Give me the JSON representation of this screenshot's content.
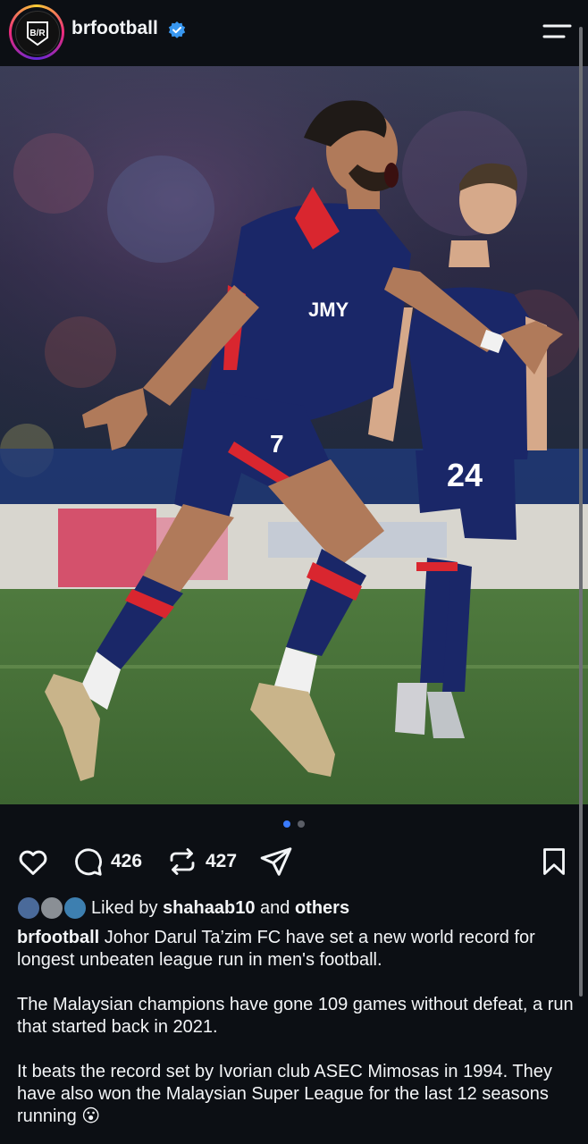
{
  "header": {
    "username": "brfootball",
    "avatar_text": "B/R",
    "verified_icon": "verified-badge-icon",
    "menu_icon": "hamburger-menu-icon"
  },
  "media": {
    "shirt_sponsor": "JMY",
    "player_number_front": "7",
    "player_number_back": "24",
    "carousel_pages": 2,
    "carousel_active_page": 1
  },
  "actions": {
    "like_icon": "heart-icon",
    "comment_icon": "comment-icon",
    "comment_count": "426",
    "repost_icon": "repost-icon",
    "repost_count": "427",
    "share_icon": "send-icon",
    "save_icon": "bookmark-icon"
  },
  "likes": {
    "prefix": "Liked by",
    "user": "shahaab10",
    "joiner": "and",
    "others": "others"
  },
  "caption": {
    "username": "brfootball",
    "para1": "Johor Darul Ta’zim FC have set a new world record for longest unbeaten league run in men's football.",
    "para2": "The Malaysian champions have gone 109 games without defeat, a run that started back in 2021.",
    "para3": "It beats the record set by Ivorian club ASEC Mimosas in 1994. They have also won the Malaysian Super League for the last 12 seasons running",
    "emoji": "😮"
  },
  "colors": {
    "background": "#0c0f14",
    "verified_blue": "#3897f0",
    "dot_active": "#3a7bfd",
    "dot_inactive": "#5b5e66",
    "kit_navy": "#1a2768",
    "kit_red": "#d9262f"
  }
}
